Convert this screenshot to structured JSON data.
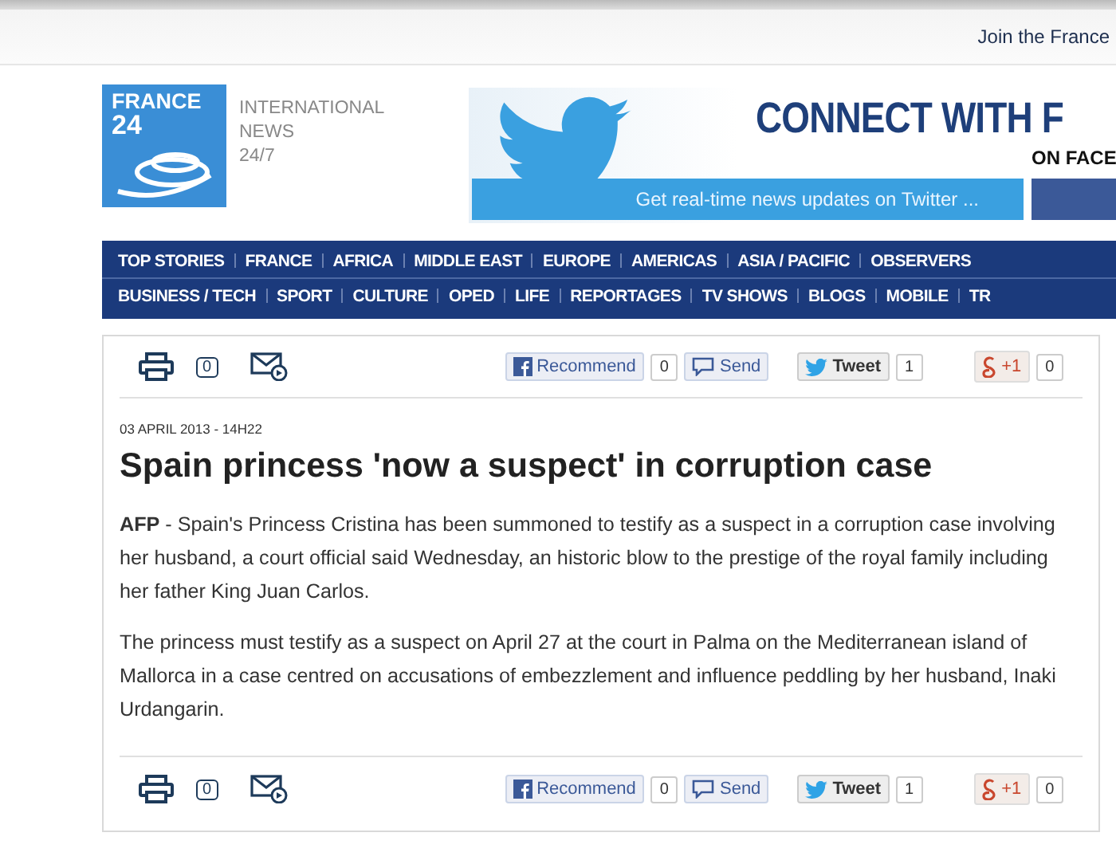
{
  "top_bar": {
    "link": "Join the France"
  },
  "logo": {
    "name_lines": [
      "FRANCE",
      "24"
    ],
    "tagline": [
      "INTERNATIONAL",
      "NEWS",
      "24/7"
    ]
  },
  "banner": {
    "headline": "CONNECT WITH F",
    "subline": "ON FACE",
    "cta": "Get real-time news updates on Twitter ..."
  },
  "nav": {
    "upper_links": [
      "TOP STORIES",
      "FRANCE",
      "AFRICA",
      "MIDDLE EAST",
      "EUROPE",
      "AMERICAS",
      "ASIA / PACIFIC",
      "OBSERVERS"
    ],
    "lower_links": [
      "BUSINESS / TECH",
      "SPORT",
      "CULTURE",
      "OPED",
      "LIFE",
      "REPORTAGES",
      "TV SHOWS",
      "BLOGS",
      "MOBILE",
      "TR"
    ]
  },
  "article": {
    "share_bars": [
      {
        "comment_count": "0",
        "buttons": [
          {
            "kind": "facebook",
            "label": "Recommend",
            "count": "0"
          },
          {
            "kind": "send",
            "label": "Send"
          },
          {
            "kind": "twitter",
            "label": "Tweet",
            "count": "1"
          },
          {
            "kind": "gplus",
            "label": "+1",
            "count": "0"
          }
        ]
      },
      {
        "comment_count": "0",
        "buttons": [
          {
            "kind": "facebook",
            "label": "Recommend",
            "count": "0"
          },
          {
            "kind": "send",
            "label": "Send"
          },
          {
            "kind": "twitter",
            "label": "Tweet",
            "count": "1"
          },
          {
            "kind": "gplus",
            "label": "+1",
            "count": "0"
          }
        ]
      }
    ],
    "date": "03 APRIL 2013 - 14H22",
    "title": "Spain princess 'now a suspect' in corruption case",
    "paragraphs": [
      "**AFP** - Spain's Princess Cristina has been summoned to testify as a suspect in a corruption case involving her husband, a court official said Wednesday, an historic blow to the prestige of the royal family including her father King Juan Carlos.",
      "The princess must testify as a suspect on April 27 at the court in Palma on the Mediterranean island of Mallorca in a case centred on accusations of embezzlement and influence peddling by her husband, Inaki Urdangarin."
    ]
  }
}
